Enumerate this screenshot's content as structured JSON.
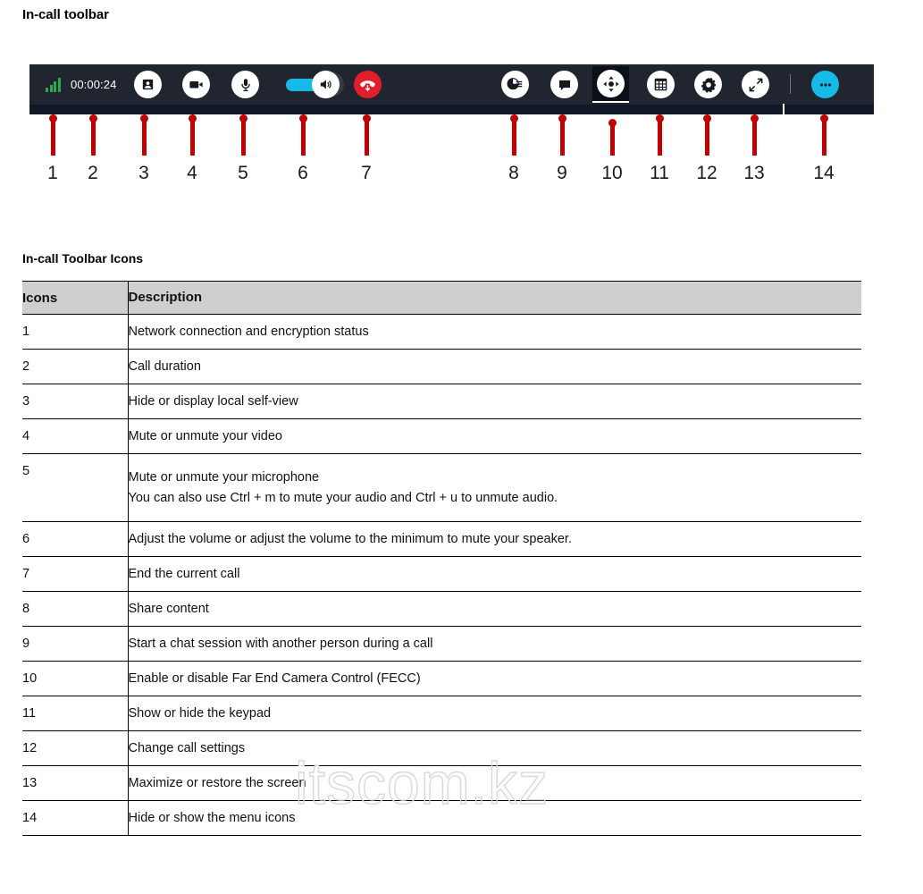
{
  "page": {
    "heading": "In-call toolbar",
    "section_heading": "In-call Toolbar Icons",
    "watermark": "itscom.kz"
  },
  "toolbar": {
    "background_top": "#20252f",
    "background_bottom": "#111827",
    "signal_color": "#2fa84f",
    "accent_cyan": "#16bae7",
    "end_call_red": "#e01f2b",
    "call_duration": "00:00:24",
    "items": [
      {
        "n": "1",
        "name": "network-signal-icon",
        "label": "Network connection and encryption status"
      },
      {
        "n": "2",
        "name": "call-duration-text",
        "label": "Call duration"
      },
      {
        "n": "3",
        "name": "self-view-icon",
        "label": "Hide or display local self-view"
      },
      {
        "n": "4",
        "name": "video-camera-icon",
        "label": "Mute or unmute your video"
      },
      {
        "n": "5",
        "name": "microphone-icon",
        "label": "Mute or unmute your microphone"
      },
      {
        "n": "6",
        "name": "volume-slider",
        "label": "Adjust the volume"
      },
      {
        "n": "7",
        "name": "end-call-icon",
        "label": "End the current call"
      },
      {
        "n": "8",
        "name": "share-content-icon",
        "label": "Share content"
      },
      {
        "n": "9",
        "name": "chat-bubble-icon",
        "label": "Start a chat session"
      },
      {
        "n": "10",
        "name": "far-end-camera-control-icon",
        "label": "Far End Camera Control",
        "active": true
      },
      {
        "n": "11",
        "name": "keypad-icon",
        "label": "Show or hide the keypad"
      },
      {
        "n": "12",
        "name": "settings-gear-icon",
        "label": "Change call settings"
      },
      {
        "n": "13",
        "name": "maximize-icon",
        "label": "Maximize or restore the screen"
      },
      {
        "n": "14",
        "name": "more-menu-icon",
        "label": "Hide or show the menu icons"
      }
    ],
    "callout_numbers": [
      "1",
      "2",
      "3",
      "4",
      "5",
      "6",
      "7",
      "8",
      "9",
      "10",
      "11",
      "12",
      "13",
      "14"
    ]
  },
  "table": {
    "columns": [
      "Icons",
      "Description"
    ],
    "rows": [
      {
        "icon": "1",
        "desc": "Network connection and encryption status",
        "desc2": ""
      },
      {
        "icon": "2",
        "desc": "Call duration",
        "desc2": ""
      },
      {
        "icon": "3",
        "desc": "Hide or display local self-view",
        "desc2": ""
      },
      {
        "icon": "4",
        "desc": "Mute or unmute your video",
        "desc2": ""
      },
      {
        "icon": "5",
        "desc": "Mute or unmute your microphone",
        "desc2": "You can also use Ctrl + m to mute your audio and Ctrl + u to unmute audio."
      },
      {
        "icon": "6",
        "desc": "Adjust the volume or adjust the volume to the minimum to mute your speaker.",
        "desc2": ""
      },
      {
        "icon": "7",
        "desc": "End the current call",
        "desc2": ""
      },
      {
        "icon": "8",
        "desc": "Share content",
        "desc2": ""
      },
      {
        "icon": "9",
        "desc": "Start a chat session with another person during a call",
        "desc2": ""
      },
      {
        "icon": "10",
        "desc": "Enable or disable Far End Camera Control (FECC)",
        "desc2": ""
      },
      {
        "icon": "11",
        "desc": "Show or hide the keypad",
        "desc2": ""
      },
      {
        "icon": "12",
        "desc": "Change call settings",
        "desc2": ""
      },
      {
        "icon": "13",
        "desc": "Maximize or restore the screen",
        "desc2": ""
      },
      {
        "icon": "14",
        "desc": "Hide or show the menu icons",
        "desc2": ""
      }
    ]
  }
}
